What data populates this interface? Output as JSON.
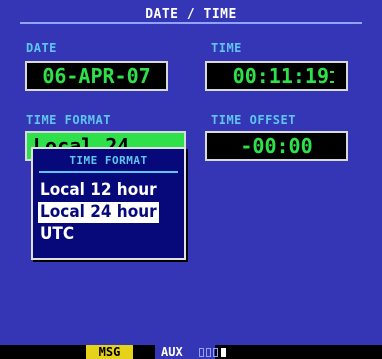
{
  "page_title": "DATE / TIME",
  "date": {
    "label": "DATE",
    "value": "06-APR-07"
  },
  "time": {
    "label": "TIME",
    "value": "00:11:19"
  },
  "time_format": {
    "label": "TIME FORMAT",
    "value": "Local 24 hour"
  },
  "time_offset": {
    "label": "TIME OFFSET",
    "value": "-00:00"
  },
  "popup": {
    "title": "TIME FORMAT",
    "options": [
      "Local 12 hour",
      "Local 24 hour",
      "UTC"
    ],
    "selected": "Local 24 hour"
  },
  "status_bar": {
    "msg": "MSG",
    "page_group": "AUX",
    "page_count": 4,
    "current_page": 4
  },
  "colors": {
    "background": "#3436b5",
    "label": "#5ec6ee",
    "field_text": "#2ee04a",
    "msg_highlight": "#e6d21a"
  }
}
